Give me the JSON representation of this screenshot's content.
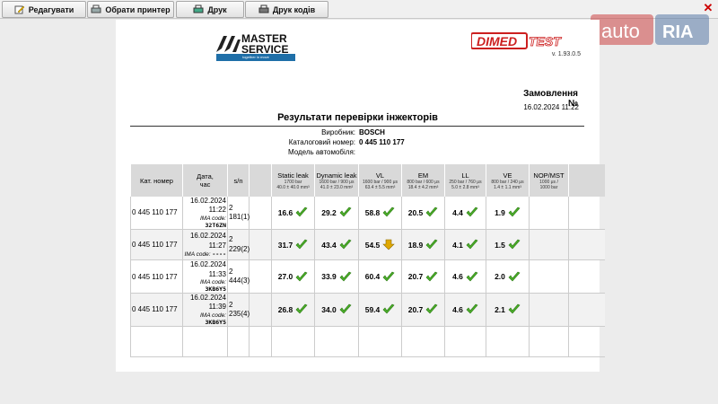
{
  "toolbar": {
    "edit_label": "Редагувати",
    "printer_label": "Обрати принтер",
    "print_label": "Друк",
    "print_codes_label": "Друк кодів"
  },
  "watermark": {
    "text_auto": "auto",
    "text_ria": "RIA"
  },
  "report": {
    "brand_line1": "MASTER",
    "brand_line2": "SERVICE",
    "brand_tagline": "together in move",
    "version": "v. 1.93.0.5",
    "order_label": "Замовлення №",
    "order_datetime": "16.02.2024  11:22",
    "title": "Результати перевірки інжекторів",
    "manufacturer_label": "Виробник:",
    "manufacturer_value": "BOSCH",
    "catalog_label": "Каталоговий номер:",
    "catalog_value": "0 445 110 177",
    "car_model_label": "Модель автомобіля:",
    "car_model_value": ""
  },
  "table": {
    "headers": {
      "cat_no": "Кат. номер",
      "date": "Дата,",
      "time": "час",
      "sn": "s/n",
      "static_leak": "Static leak",
      "static_leak_sub1": "1700 bar",
      "static_leak_sub2": "40.0 ± 40.0 mm³",
      "dynamic_leak": "Dynamic leak",
      "dynamic_leak_sub1": "1600 bar / 900 μs",
      "dynamic_leak_sub2": "41.0 ± 23.0 mm³",
      "vl": "VL",
      "vl_sub1": "1600 bar / 900 μs",
      "vl_sub2": "63.4 ± 5.5 mm³",
      "em": "EM",
      "em_sub1": "800 bar / 600 μs",
      "em_sub2": "18.4 ± 4.2 mm³",
      "ll": "LL",
      "ll_sub1": "250 bar / 760 μs",
      "ll_sub2": "5.0 ± 2.8 mm³",
      "ve": "VE",
      "ve_sub1": "800 bar / 240 μs",
      "ve_sub2": "1.4 ± 1.1 mm³",
      "nop": "NOP/MST",
      "nop_sub1": "1000 μs /",
      "nop_sub2": "1000 bar"
    },
    "ima_label": "IMA code:",
    "rows": [
      {
        "cat": "0 445 110 177",
        "date": "16.02.2024",
        "time": "11:22",
        "sn1": "2",
        "sn2": "181(1)",
        "ima": "32T6ZN",
        "static": "16.6",
        "dynamic": "29.2",
        "vl": "58.8",
        "em": "20.5",
        "ll": "4.4",
        "ve": "1.9"
      },
      {
        "cat": "0 445 110 177",
        "date": "16.02.2024",
        "time": "11:27",
        "sn1": "2",
        "sn2": "229(2)",
        "ima": "----",
        "static": "31.7",
        "dynamic": "43.4",
        "vl": "54.5",
        "em": "18.9",
        "ll": "4.1",
        "ve": "1.5"
      },
      {
        "cat": "0 445 110 177",
        "date": "16.02.2024",
        "time": "11:33",
        "sn1": "2",
        "sn2": "444(3)",
        "ima": "3KB6Y5",
        "static": "27.0",
        "dynamic": "33.9",
        "vl": "60.4",
        "em": "20.7",
        "ll": "4.6",
        "ve": "2.0"
      },
      {
        "cat": "0 445 110 177",
        "date": "16.02.2024",
        "time": "11:39",
        "sn1": "2",
        "sn2": "235(4)",
        "ima": "3KB6Y5",
        "static": "26.8",
        "dynamic": "34.0",
        "vl": "59.4",
        "em": "20.7",
        "ll": "4.6",
        "ve": "2.1"
      }
    ]
  },
  "colors": {
    "ok": "#4caf2a",
    "warn": "#e0a800",
    "brand_blue": "#1f6fa8",
    "dimed_red": "#cc1f1f"
  }
}
